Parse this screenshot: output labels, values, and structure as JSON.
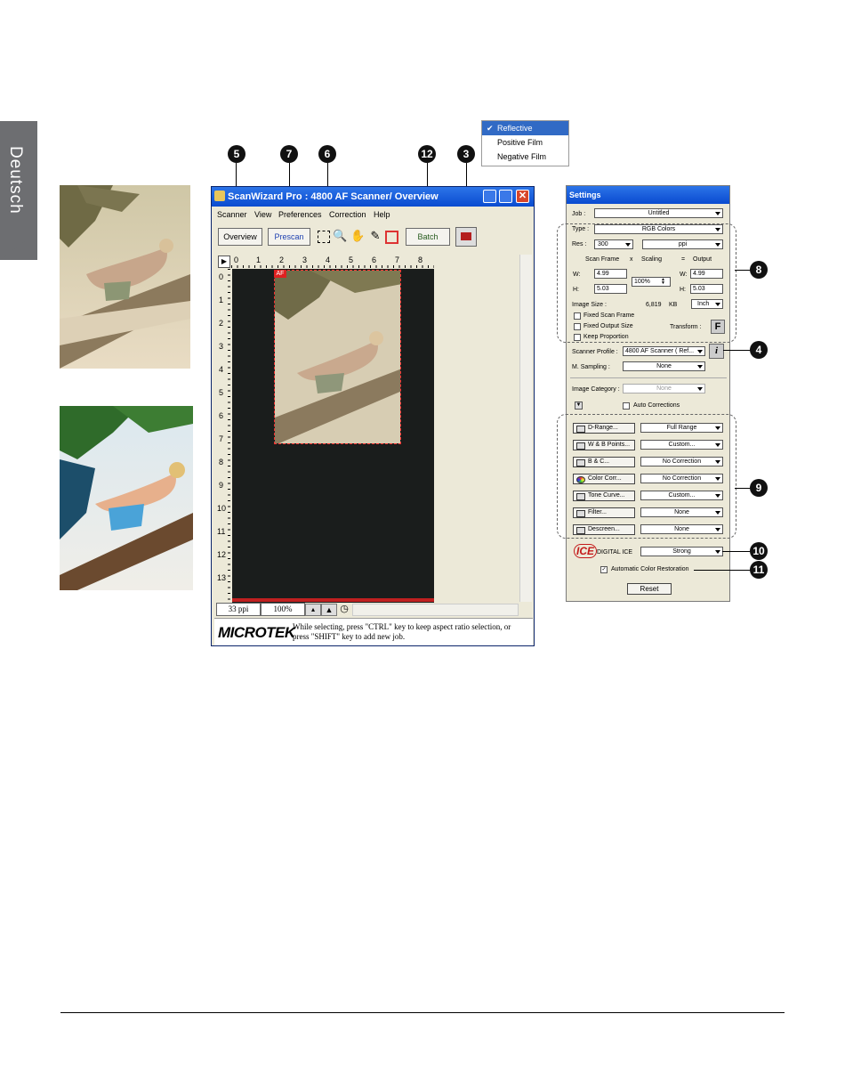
{
  "side_tab": {
    "label": "Deutsch"
  },
  "scan_mode_menu": {
    "items": [
      "Reflective",
      "Positive Film",
      "Negative Film"
    ],
    "selected": "Reflective"
  },
  "callouts": {
    "c5": "5",
    "c7": "7",
    "c6": "6",
    "c12": "12",
    "c3": "3",
    "c8": "8",
    "c4": "4",
    "c9": "9",
    "c10": "10",
    "c11": "11"
  },
  "window": {
    "title": "ScanWizard Pro : 4800 AF Scanner/ Overview",
    "menus": [
      "Scanner",
      "View",
      "Preferences",
      "Correction",
      "Help"
    ],
    "toolbar": {
      "overview": "Overview",
      "prescan": "Prescan",
      "batch": "Batch"
    },
    "ruler_top": [
      "0",
      "1",
      "2",
      "3",
      "4",
      "5",
      "6",
      "7",
      "8"
    ],
    "ruler_left": [
      "0",
      "1",
      "2",
      "3",
      "4",
      "5",
      "6",
      "7",
      "8",
      "9",
      "10",
      "11",
      "12",
      "13"
    ],
    "af_tag": "AF",
    "status": {
      "ppi": "33 ppi",
      "zoom": "100%"
    },
    "footer": {
      "logo": "MICROTEK",
      "hint": "While selecting, press \"CTRL\" key to keep aspect ratio selection, or press \"SHIFT\" key to add new job."
    }
  },
  "settings": {
    "title": "Settings",
    "job_label": "Job :",
    "job_value": "Untitled",
    "type_label": "Type :",
    "type_value": "RGB Colors",
    "res_label": "Res :",
    "res_value": "300",
    "res_unit": "ppi",
    "col_scan_frame": "Scan Frame",
    "col_x": "x",
    "col_scaling": "Scaling",
    "col_eq": "=",
    "col_output": "Output",
    "w_label": "W:",
    "h_label": "H:",
    "scan_w": "4.99",
    "scan_h": "5.03",
    "scaling": "100%",
    "out_w": "4.99",
    "out_h": "5.03",
    "image_size_label": "Image Size :",
    "image_size_value": "6,819",
    "image_size_unit": "KB",
    "unit": "Inch",
    "fixed_scan_frame": "Fixed Scan Frame",
    "fixed_output_size": "Fixed Output Size",
    "keep_proportion": "Keep Proportion",
    "transform_label": "Transform :",
    "transform_icon": "F",
    "scanner_profile_label": "Scanner Profile :",
    "scanner_profile_value": "4800 AF Scanner ( Ref...",
    "m_sampling_label": "M. Sampling :",
    "m_sampling_value": "None",
    "image_category_label": "Image Category :",
    "image_category_value": "None",
    "auto_corrections": "Auto Corrections",
    "tools": [
      {
        "label": "D-Range...",
        "value": "Full Range"
      },
      {
        "label": "W & B Points...",
        "value": "Custom..."
      },
      {
        "label": "B & C...",
        "value": "No Correction"
      },
      {
        "label": "Color Corr...",
        "value": "No Correction"
      },
      {
        "label": "Tone Curve...",
        "value": "Custom..."
      },
      {
        "label": "Filter...",
        "value": "None"
      },
      {
        "label": "Descreen...",
        "value": "None"
      }
    ],
    "ice_logo": "ICE",
    "ice_label": "DIGITAL ICE",
    "ice_value": "Strong",
    "auto_color_restoration": "Automatic Color Restoration",
    "reset": "Reset"
  }
}
